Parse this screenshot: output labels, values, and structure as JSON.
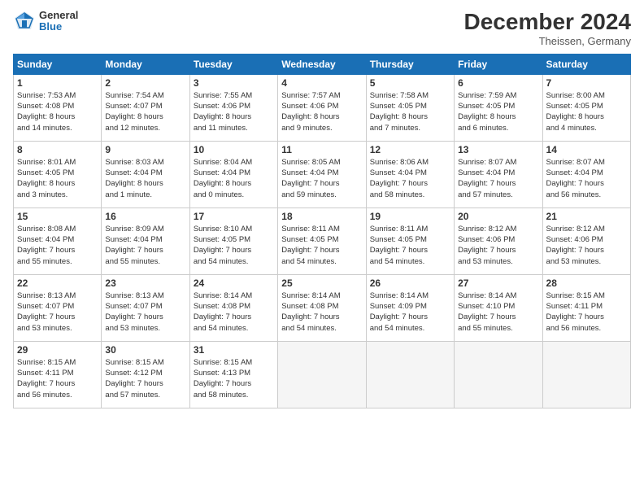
{
  "header": {
    "logo_general": "General",
    "logo_blue": "Blue",
    "month_title": "December 2024",
    "location": "Theissen, Germany"
  },
  "weekdays": [
    "Sunday",
    "Monday",
    "Tuesday",
    "Wednesday",
    "Thursday",
    "Friday",
    "Saturday"
  ],
  "weeks": [
    [
      {
        "day": "1",
        "info": "Sunrise: 7:53 AM\nSunset: 4:08 PM\nDaylight: 8 hours\nand 14 minutes."
      },
      {
        "day": "2",
        "info": "Sunrise: 7:54 AM\nSunset: 4:07 PM\nDaylight: 8 hours\nand 12 minutes."
      },
      {
        "day": "3",
        "info": "Sunrise: 7:55 AM\nSunset: 4:06 PM\nDaylight: 8 hours\nand 11 minutes."
      },
      {
        "day": "4",
        "info": "Sunrise: 7:57 AM\nSunset: 4:06 PM\nDaylight: 8 hours\nand 9 minutes."
      },
      {
        "day": "5",
        "info": "Sunrise: 7:58 AM\nSunset: 4:05 PM\nDaylight: 8 hours\nand 7 minutes."
      },
      {
        "day": "6",
        "info": "Sunrise: 7:59 AM\nSunset: 4:05 PM\nDaylight: 8 hours\nand 6 minutes."
      },
      {
        "day": "7",
        "info": "Sunrise: 8:00 AM\nSunset: 4:05 PM\nDaylight: 8 hours\nand 4 minutes."
      }
    ],
    [
      {
        "day": "8",
        "info": "Sunrise: 8:01 AM\nSunset: 4:05 PM\nDaylight: 8 hours\nand 3 minutes."
      },
      {
        "day": "9",
        "info": "Sunrise: 8:03 AM\nSunset: 4:04 PM\nDaylight: 8 hours\nand 1 minute."
      },
      {
        "day": "10",
        "info": "Sunrise: 8:04 AM\nSunset: 4:04 PM\nDaylight: 8 hours\nand 0 minutes."
      },
      {
        "day": "11",
        "info": "Sunrise: 8:05 AM\nSunset: 4:04 PM\nDaylight: 7 hours\nand 59 minutes."
      },
      {
        "day": "12",
        "info": "Sunrise: 8:06 AM\nSunset: 4:04 PM\nDaylight: 7 hours\nand 58 minutes."
      },
      {
        "day": "13",
        "info": "Sunrise: 8:07 AM\nSunset: 4:04 PM\nDaylight: 7 hours\nand 57 minutes."
      },
      {
        "day": "14",
        "info": "Sunrise: 8:07 AM\nSunset: 4:04 PM\nDaylight: 7 hours\nand 56 minutes."
      }
    ],
    [
      {
        "day": "15",
        "info": "Sunrise: 8:08 AM\nSunset: 4:04 PM\nDaylight: 7 hours\nand 55 minutes."
      },
      {
        "day": "16",
        "info": "Sunrise: 8:09 AM\nSunset: 4:04 PM\nDaylight: 7 hours\nand 55 minutes."
      },
      {
        "day": "17",
        "info": "Sunrise: 8:10 AM\nSunset: 4:05 PM\nDaylight: 7 hours\nand 54 minutes."
      },
      {
        "day": "18",
        "info": "Sunrise: 8:11 AM\nSunset: 4:05 PM\nDaylight: 7 hours\nand 54 minutes."
      },
      {
        "day": "19",
        "info": "Sunrise: 8:11 AM\nSunset: 4:05 PM\nDaylight: 7 hours\nand 54 minutes."
      },
      {
        "day": "20",
        "info": "Sunrise: 8:12 AM\nSunset: 4:06 PM\nDaylight: 7 hours\nand 53 minutes."
      },
      {
        "day": "21",
        "info": "Sunrise: 8:12 AM\nSunset: 4:06 PM\nDaylight: 7 hours\nand 53 minutes."
      }
    ],
    [
      {
        "day": "22",
        "info": "Sunrise: 8:13 AM\nSunset: 4:07 PM\nDaylight: 7 hours\nand 53 minutes."
      },
      {
        "day": "23",
        "info": "Sunrise: 8:13 AM\nSunset: 4:07 PM\nDaylight: 7 hours\nand 53 minutes."
      },
      {
        "day": "24",
        "info": "Sunrise: 8:14 AM\nSunset: 4:08 PM\nDaylight: 7 hours\nand 54 minutes."
      },
      {
        "day": "25",
        "info": "Sunrise: 8:14 AM\nSunset: 4:08 PM\nDaylight: 7 hours\nand 54 minutes."
      },
      {
        "day": "26",
        "info": "Sunrise: 8:14 AM\nSunset: 4:09 PM\nDaylight: 7 hours\nand 54 minutes."
      },
      {
        "day": "27",
        "info": "Sunrise: 8:14 AM\nSunset: 4:10 PM\nDaylight: 7 hours\nand 55 minutes."
      },
      {
        "day": "28",
        "info": "Sunrise: 8:15 AM\nSunset: 4:11 PM\nDaylight: 7 hours\nand 56 minutes."
      }
    ],
    [
      {
        "day": "29",
        "info": "Sunrise: 8:15 AM\nSunset: 4:11 PM\nDaylight: 7 hours\nand 56 minutes."
      },
      {
        "day": "30",
        "info": "Sunrise: 8:15 AM\nSunset: 4:12 PM\nDaylight: 7 hours\nand 57 minutes."
      },
      {
        "day": "31",
        "info": "Sunrise: 8:15 AM\nSunset: 4:13 PM\nDaylight: 7 hours\nand 58 minutes."
      },
      null,
      null,
      null,
      null
    ]
  ]
}
